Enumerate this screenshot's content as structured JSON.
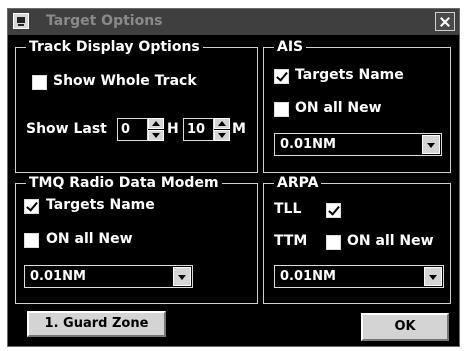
{
  "window": {
    "title": "Target Options",
    "close_icon": "close-icon"
  },
  "track_display": {
    "legend": "Track Display Options",
    "show_whole_track": {
      "label": "Show Whole Track",
      "checked": false
    },
    "show_last_label": "Show Last",
    "hours": {
      "value": "0",
      "unit": "H"
    },
    "minutes": {
      "value": "10",
      "unit": "M"
    }
  },
  "ais": {
    "legend": "AIS",
    "targets_name": {
      "label": "Targets Name",
      "checked": true
    },
    "on_all_new": {
      "label": "ON all New",
      "checked": false
    },
    "range": "0.01NM"
  },
  "tmq": {
    "legend": "TMQ Radio Data Modem",
    "targets_name": {
      "label": "Targets Name",
      "checked": true
    },
    "on_all_new": {
      "label": "ON all New",
      "checked": false
    },
    "range": "0.01NM"
  },
  "arpa": {
    "legend": "ARPA",
    "tll": {
      "label": "TLL",
      "checked": true
    },
    "ttm": {
      "label": "TTM"
    },
    "on_all_new": {
      "label": "ON all New",
      "checked": false
    },
    "range": "0.01NM"
  },
  "buttons": {
    "guard_zone": "1. Guard Zone",
    "ok": "OK"
  }
}
